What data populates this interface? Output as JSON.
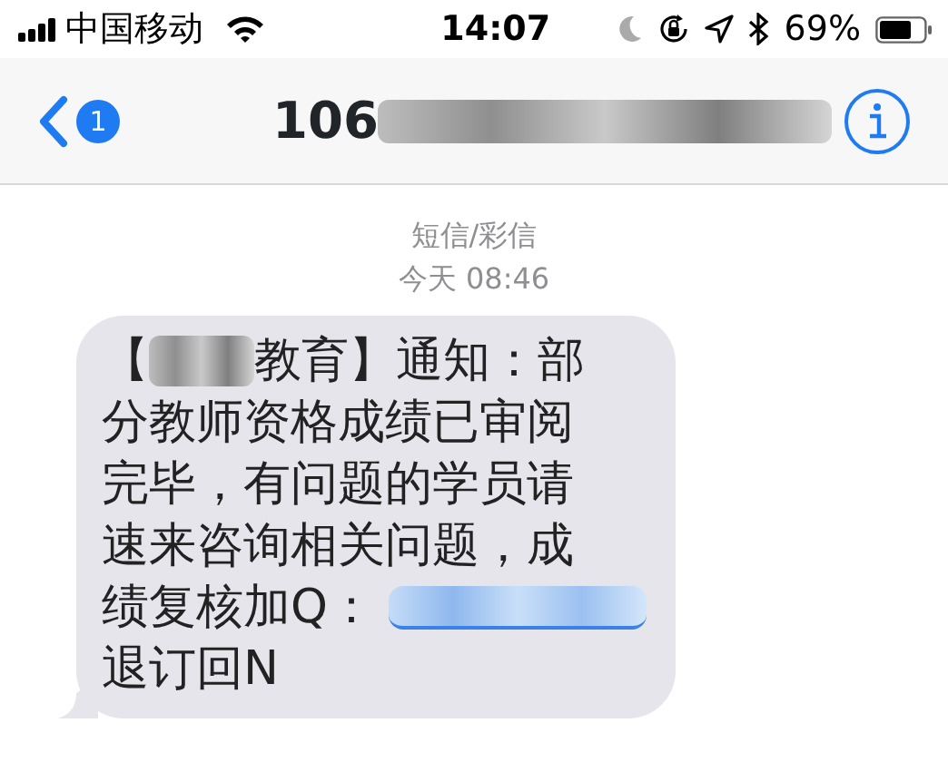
{
  "status_bar": {
    "carrier": "中国移动",
    "time": "14:07",
    "battery": "69%"
  },
  "nav": {
    "back_badge": "1",
    "title": "106"
  },
  "thread": {
    "service": "短信/彩信",
    "timestamp": "今天 08:46"
  },
  "messages": [
    {
      "lines": [
        [
          {
            "kind": "text",
            "text": "【"
          },
          {
            "kind": "redacted"
          },
          {
            "kind": "text",
            "text": "教育】通知：部"
          }
        ],
        [
          {
            "kind": "text",
            "text": "分教师资格成绩已审阅"
          }
        ],
        [
          {
            "kind": "text",
            "text": "完毕，有问题的学员请"
          }
        ],
        [
          {
            "kind": "text",
            "text": "速来咨询相关问题，成"
          }
        ],
        [
          {
            "kind": "text",
            "text": "绩复核加Q："
          },
          {
            "kind": "redacted_link"
          }
        ],
        [
          {
            "kind": "text",
            "text": "退订回N"
          }
        ]
      ]
    }
  ]
}
